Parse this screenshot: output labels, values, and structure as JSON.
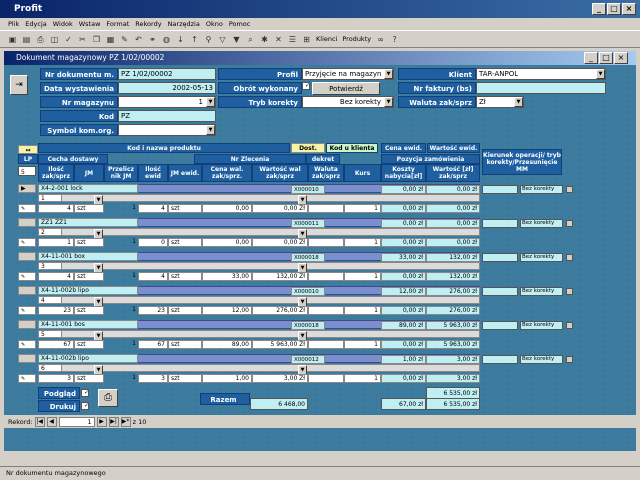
{
  "app": {
    "title": "Profit"
  },
  "menu": [
    "Plik",
    "Edycja",
    "Widok",
    "Wstaw",
    "Format",
    "Rekordy",
    "Narzędzia",
    "Okno",
    "Pomoc"
  ],
  "toolbar": {
    "klienci": "Klienci",
    "produkty": "Produkty"
  },
  "doc": {
    "title": "Dokument magazynowy PZ 1/02/00002"
  },
  "header": {
    "nr_dokumentu_label": "Nr dokumentu m.",
    "nr_dokumentu": "PZ 1/02/00002",
    "profil_label": "Profil",
    "profil": "Przyjęcie na magazyn",
    "klient_label": "Klient",
    "klient": "TAR-ANPOL",
    "data_label": "Data wystawienia",
    "data": "2002-05-13",
    "obrot_label": "Obrót wykonany",
    "potwierdz": "Potwierdź",
    "nr_faktury_label": "Nr faktury (bs)",
    "nr_faktury": "",
    "nr_magazynu_label": "Nr magazynu",
    "nr_magazynu": "1",
    "tryb_label": "Tryb korekty",
    "tryb": "Bez korekty",
    "waluta_label": "Waluta zak/sprz",
    "waluta": "Zł",
    "kod_label": "Kod",
    "kod": "PZ",
    "symbol_label": "Symbol kom.org.",
    "symbol": ""
  },
  "columns": {
    "kod_nazwa": "Kod i nazwa produktu",
    "dost": "Dost.",
    "kod_klienta": "Kod u klienta",
    "cena_ewid": "Cena ewid.",
    "wartosc_ewid": "Wartość ewid.",
    "lp": "LP",
    "cecha": "Cecha dostawy",
    "nr_zlecenia": "Nr Zlecenia",
    "dekret": "dekret",
    "pozycja": "Pozycja zamówienia",
    "ilosc": "Ilość zak/sprz",
    "jm": "JM",
    "przelicz": "Przelicz nik JM",
    "ilosc_ewid": "Ilość ewid",
    "jm_ewid": "JM ewid.",
    "cena_wal": "Cena wal. zak/sprz.",
    "wartosc_wal": "Wartość wal zak/sprz",
    "waluta": "Waluta zak/sprz",
    "kurs": "Kurs",
    "koszty": "Koszty nabycia[zł]",
    "wartosc_zl": "Wartość [zł] zak/sprz",
    "kierunek": "Kierunek operacji/ tryb korekty/Przesunięcie MM",
    "lp_sel": "5"
  },
  "rows": [
    {
      "lp": "1",
      "kod": "X4-2-001 lock",
      "dekret": "X000010",
      "cena": "0,00 zł",
      "wart": "0,00 zł",
      "ilosc": "4",
      "jm": "szt",
      "przel": "1",
      "il_ewid": "4",
      "jm_ewid": "szt",
      "cena_wal": "0,00",
      "wart_wal": "0,00 Zł",
      "kurs": "1",
      "koszty": "0,00 zł",
      "wart_zl": "0,00 zł",
      "kier": "",
      "tryb": "Bez korekty"
    },
    {
      "lp": "2",
      "kod": "ZZ1 ZZ1",
      "dekret": "X000011",
      "cena": "0,00 zł",
      "wart": "0,00 zł",
      "ilosc": "1",
      "jm": "szt",
      "przel": "1",
      "il_ewid": "0",
      "jm_ewid": "szt",
      "cena_wal": "0,00",
      "wart_wal": "0,00 Zł",
      "kurs": "1",
      "koszty": "0,00 zł",
      "wart_zl": "0,00 zł",
      "kier": "",
      "tryb": "Bez korekty"
    },
    {
      "lp": "3",
      "kod": "X4-11-001 box",
      "dekret": "X000018",
      "cena": "33,00 zł",
      "wart": "132,00 zł",
      "ilosc": "4",
      "jm": "szt",
      "przel": "1",
      "il_ewid": "4",
      "jm_ewid": "szt",
      "cena_wal": "33,00",
      "wart_wal": "132,00 Zł",
      "kurs": "1",
      "koszty": "0,00 zł",
      "wart_zl": "132,00 zł",
      "kier": "",
      "tryb": "Bez korekty"
    },
    {
      "lp": "4",
      "kod": "X4-11-002b lipo",
      "dekret": "X000010",
      "cena": "12,00 zł",
      "wart": "276,00 zł",
      "ilosc": "23",
      "jm": "szt",
      "przel": "1",
      "il_ewid": "23",
      "jm_ewid": "szt",
      "cena_wal": "12,00",
      "wart_wal": "276,00 Zł",
      "kurs": "1",
      "koszty": "0,00 zł",
      "wart_zl": "276,00 zł",
      "kier": "",
      "tryb": "Bez korekty"
    },
    {
      "lp": "5",
      "kod": "X4-11-001 bos",
      "dekret": "X000018",
      "cena": "89,00 zł",
      "wart": "5 963,00 zł",
      "ilosc": "67",
      "jm": "szt",
      "przel": "1",
      "il_ewid": "67",
      "jm_ewid": "szt",
      "cena_wal": "89,00",
      "wart_wal": "5 963,00 Zł",
      "kurs": "1",
      "koszty": "0,00 zł",
      "wart_zl": "5 963,00 zł",
      "kier": "",
      "tryb": "Bez korekty"
    },
    {
      "lp": "6",
      "kod": "X4-11-002b lipo",
      "dekret": "X000012",
      "cena": "1,00 zł",
      "wart": "3,00 zł",
      "ilosc": "3",
      "jm": "szt",
      "przel": "1",
      "il_ewid": "3",
      "jm_ewid": "szt",
      "cena_wal": "1,00",
      "wart_wal": "3,00 Zł",
      "kurs": "1",
      "koszty": "0,00 zł",
      "wart_zl": "3,00 zł",
      "kier": "",
      "tryb": "Bez korekty"
    }
  ],
  "footer": {
    "podglad": "Podgląd",
    "drukuj": "Drukuj ceny",
    "razem": "Razem",
    "razem_wal": "6 468,00",
    "razem_koszty": "67,00 zł",
    "razem_zl": "6 535,00 zł",
    "suma_ewid": "6 535,00 zł"
  },
  "nav": {
    "rekord": "Rekord:",
    "current": "1",
    "of": "z 10"
  },
  "status": "Nr dokumentu magazynowego"
}
